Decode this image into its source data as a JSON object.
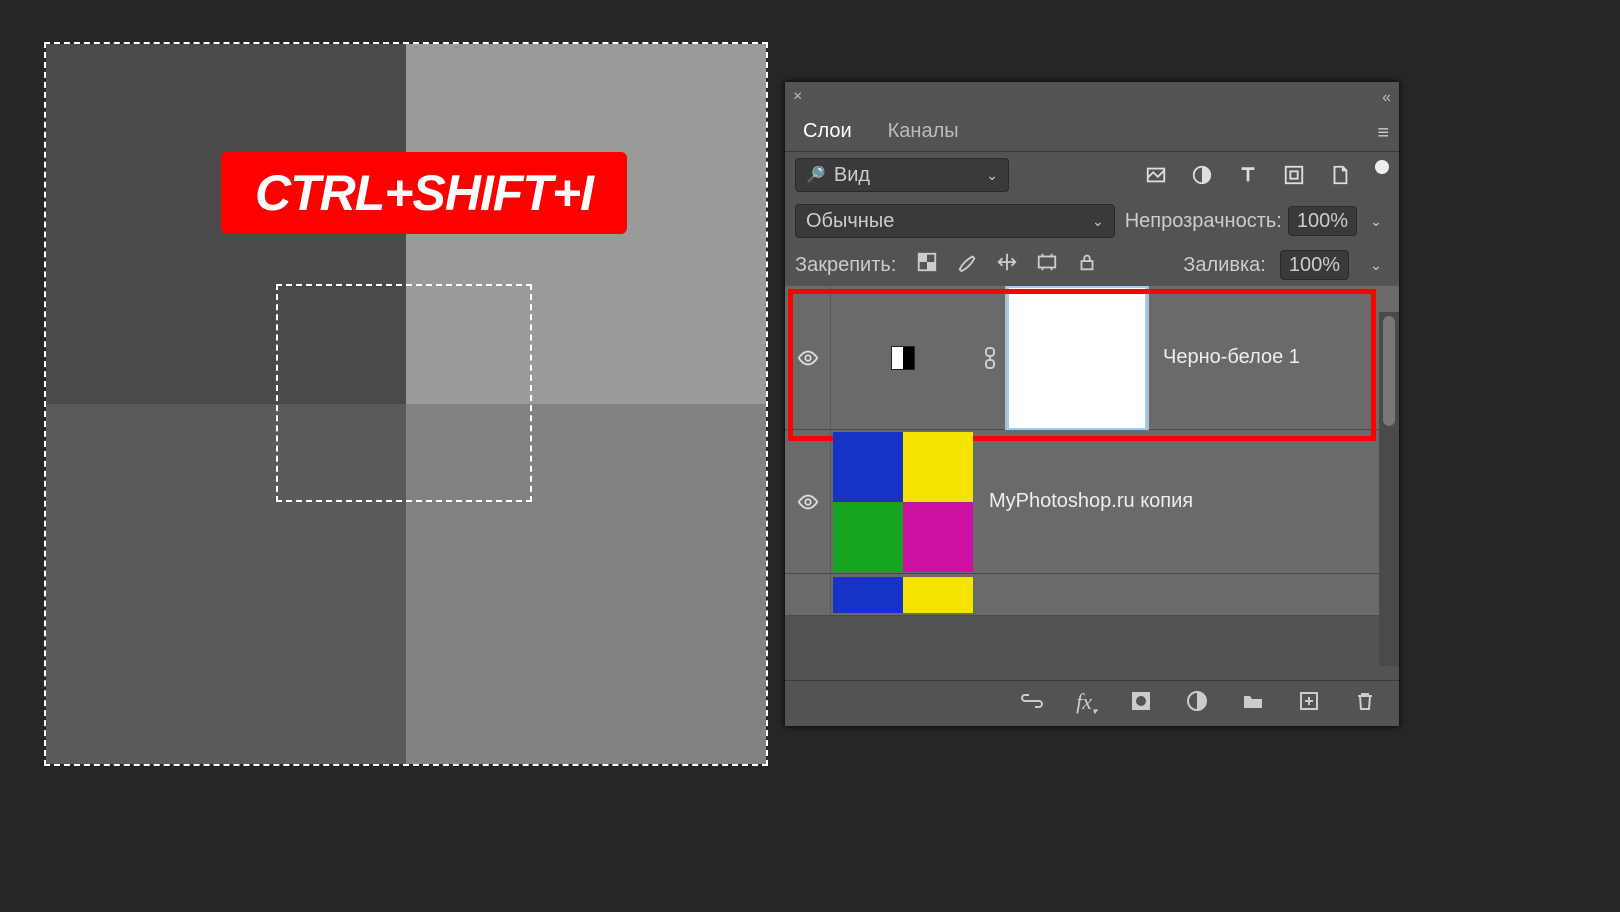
{
  "hotkey_label": "CTRL+SHIFT+I",
  "panel": {
    "tabs": {
      "layers": "Слои",
      "channels": "Каналы"
    },
    "filter_select": "Вид",
    "blend_mode": "Обычные",
    "opacity_label": "Непрозрачность:",
    "opacity_value": "100%",
    "lock_label": "Закрепить:",
    "fill_label": "Заливка:",
    "fill_value": "100%",
    "layers": [
      {
        "name": "Черно-белое 1"
      },
      {
        "name": "MyPhotoshop.ru копия"
      }
    ]
  }
}
